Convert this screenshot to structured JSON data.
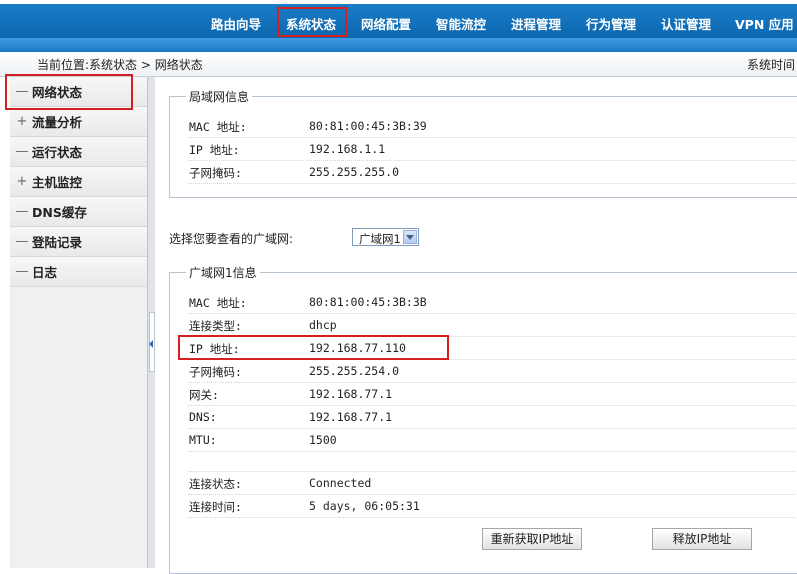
{
  "nav": {
    "items": [
      "路由向导",
      "系统状态",
      "网络配置",
      "智能流控",
      "进程管理",
      "行为管理",
      "认证管理",
      "VPN 应用"
    ],
    "active": "系统状态"
  },
  "breadcrumb": {
    "label": "当前位置:系统状态 > 网络状态",
    "right": "系统时间"
  },
  "sidebar": {
    "items": [
      {
        "sign": "—",
        "label": "网络状态"
      },
      {
        "sign": "+",
        "label": "流量分析"
      },
      {
        "sign": "—",
        "label": "运行状态"
      },
      {
        "sign": "+",
        "label": "主机监控"
      },
      {
        "sign": "—",
        "label": "DNS缓存"
      },
      {
        "sign": "—",
        "label": "登陆记录"
      },
      {
        "sign": "—",
        "label": "日志"
      }
    ]
  },
  "lan": {
    "title": "局域网信息",
    "rows": [
      {
        "k": "MAC 地址:",
        "v": "80:81:00:45:3B:39"
      },
      {
        "k": "IP 地址:",
        "v": "192.168.1.1"
      },
      {
        "k": "子网掩码:",
        "v": "255.255.255.0"
      }
    ]
  },
  "wan_select": {
    "label": "选择您要查看的广域网:",
    "value": "广域网1"
  },
  "wan": {
    "title": "广域网1信息",
    "rows": [
      {
        "k": "MAC 地址:",
        "v": "80:81:00:45:3B:3B"
      },
      {
        "k": "连接类型:",
        "v": "dhcp"
      },
      {
        "k": "IP 地址:",
        "v": "192.168.77.110"
      },
      {
        "k": "子网掩码:",
        "v": "255.255.254.0"
      },
      {
        "k": "网关:",
        "v": "192.168.77.1"
      },
      {
        "k": "DNS:",
        "v": "192.168.77.1"
      },
      {
        "k": "MTU:",
        "v": "1500"
      }
    ],
    "status_rows": [
      {
        "k": "连接状态:",
        "v": "Connected"
      },
      {
        "k": "连接时间:",
        "v": "5 days, 06:05:31"
      }
    ]
  },
  "buttons": {
    "renew": "重新获取IP地址",
    "release": "释放IP地址"
  }
}
